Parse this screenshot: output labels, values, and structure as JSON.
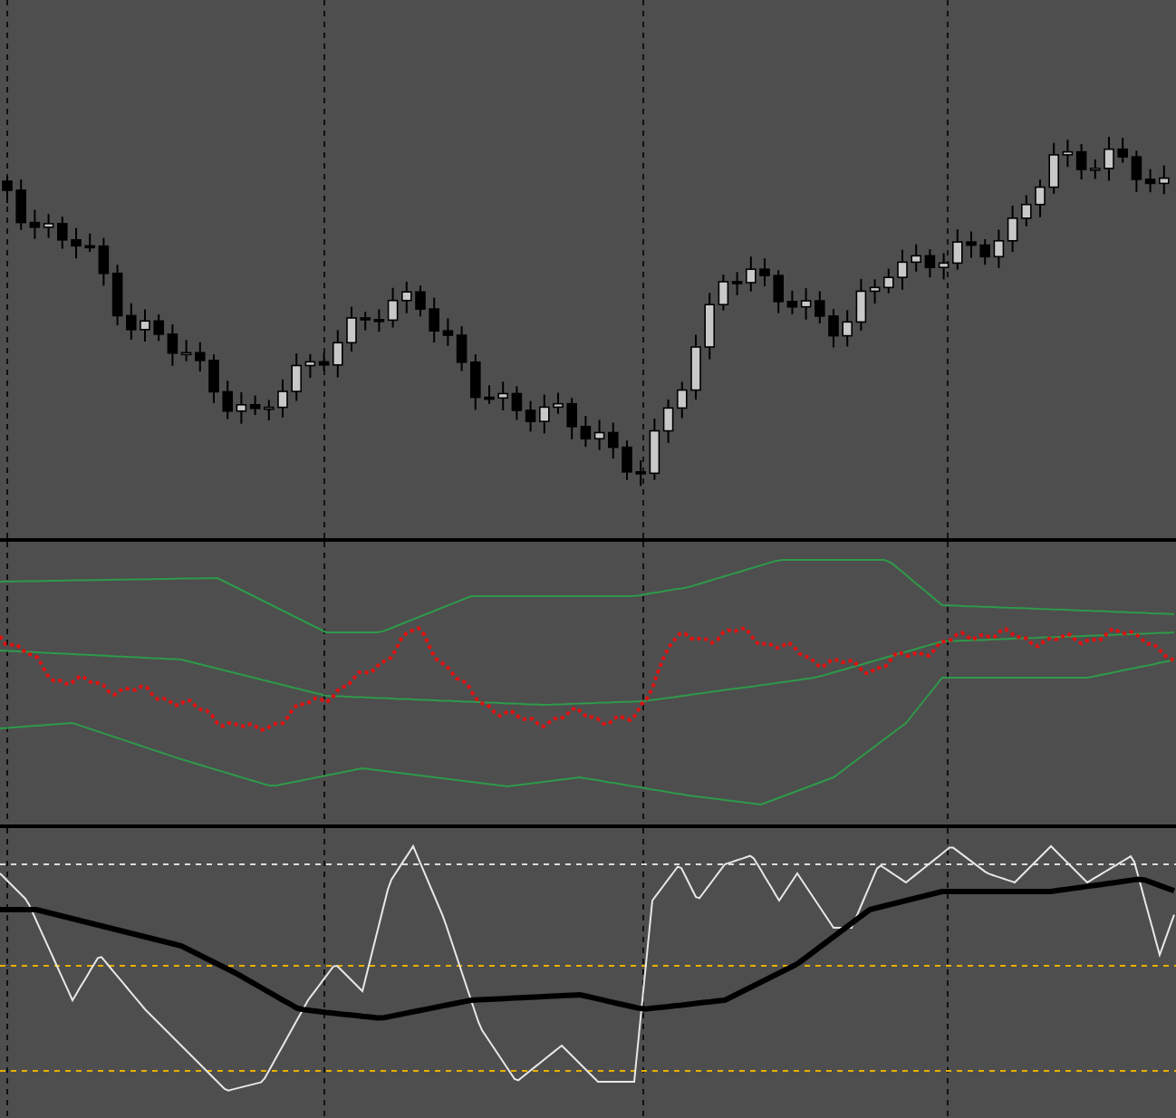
{
  "chart": {
    "panes": [
      {
        "kind": "candles"
      },
      {
        "kind": "bands"
      },
      {
        "kind": "oscillator"
      }
    ]
  }
}
